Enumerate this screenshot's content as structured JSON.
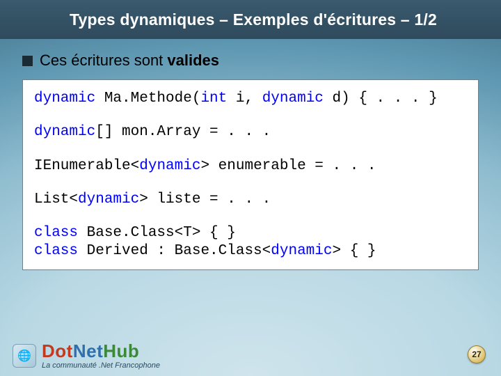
{
  "header": {
    "title": "Types dynamiques – Exemples d'écritures – 1/2"
  },
  "bullet": {
    "prefix": "Ces écritures sont ",
    "bold": "valides"
  },
  "code": {
    "l1": {
      "kw1": "dynamic",
      "t1": " Ma.Methode(",
      "kw2": "int",
      "t2": " i, ",
      "kw3": "dynamic",
      "t3": " d) { . . . }"
    },
    "l2": {
      "kw1": "dynamic",
      "t1": "[] mon.Array = . . ."
    },
    "l3": {
      "t1": "IEnumerable<",
      "kw1": "dynamic",
      "t2": "> enumerable = . . ."
    },
    "l4": {
      "t1": "List<",
      "kw1": "dynamic",
      "t2": "> liste = . . ."
    },
    "l5a": {
      "kw1": "class",
      "t1": " Base.Class<T> { }"
    },
    "l5b": {
      "kw1": "class",
      "t1": " Derived : Base.Class<",
      "kw2": "dynamic",
      "t2": "> { }"
    }
  },
  "footer": {
    "logo_badge": "🌐",
    "logo_main": "DotNetHub",
    "logo_sub": "La communauté .Net Francophone",
    "page": "27"
  }
}
